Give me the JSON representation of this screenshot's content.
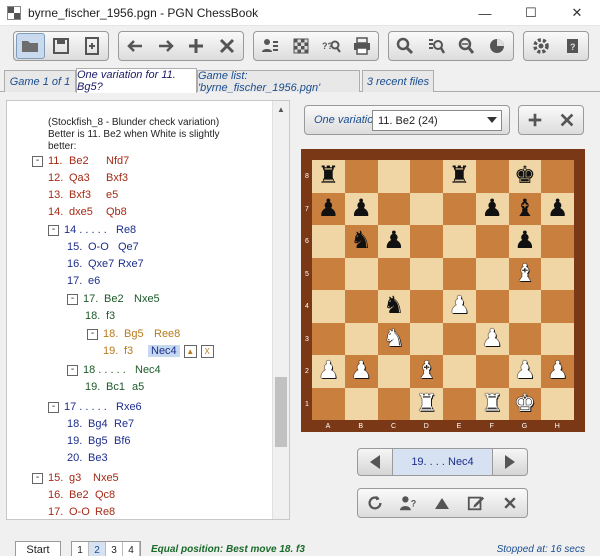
{
  "window": {
    "title": "byrne_fischer_1956.pgn - PGN ChessBook",
    "minimize": "—",
    "maximize": "☐",
    "close": "✕"
  },
  "toolbar": {
    "groups": [
      [
        "folder-open-icon",
        "save-icon",
        "new-file-icon"
      ],
      [
        "back-arrow-icon",
        "forward-arrow-icon",
        "add-icon",
        "delete-icon"
      ],
      [
        "player-list-icon",
        "board-icon",
        "search-position-icon",
        "print-icon"
      ],
      [
        "zoom-icon",
        "search-games-icon",
        "search-moves-icon",
        "stats-icon"
      ],
      [
        "settings-icon",
        "book-icon"
      ]
    ]
  },
  "tabs": [
    {
      "label": "Game 1 of 1"
    },
    {
      "label": "One variation for 11. Bg5?"
    },
    {
      "label": "Game list:  'byrne_fischer_1956.pgn'"
    },
    {
      "label": "3 recent files"
    }
  ],
  "tree": {
    "comment": "(Stockfish_8 - Blunder check variation) Better is  11. Be2  when White is slightly better:",
    "lines": [
      {
        "tog": "-",
        "num": "11.",
        "w": "Be2",
        "b": "Nfd7",
        "color": "red"
      },
      {
        "num": "12.",
        "w": "Qa3",
        "b": "Bxf3",
        "color": "red"
      },
      {
        "num": "13.",
        "w": "Bxf3",
        "b": "e5",
        "color": "red"
      },
      {
        "num": "14.",
        "w": "dxe5",
        "b": "Qb8",
        "color": "red"
      },
      {
        "tog": "-",
        "num": "14 . . . . .",
        "w": "",
        "b": "Re8",
        "color": "blue"
      },
      {
        "num": "15.",
        "w": "O-O",
        "b": "Qe7",
        "color": "blue"
      },
      {
        "num": "16.",
        "w": "Qxe7",
        "b": "Rxe7",
        "color": "blue"
      },
      {
        "num": "17.",
        "w": "e6",
        "b": "",
        "color": "green"
      },
      {
        "tog": "-",
        "num": "17.",
        "w": "Be2",
        "b": "Nxe5",
        "color": "green"
      },
      {
        "num": "18.",
        "w": "f3",
        "b": "",
        "color": "green"
      },
      {
        "tog": "-",
        "num": "18.",
        "w": "Bg5",
        "b": "Ree8",
        "color": "orange"
      },
      {
        "num": "19.",
        "w": "f3",
        "b": "Nec4",
        "color": "orange"
      },
      {
        "tog": "-",
        "num": "18 . . . . .",
        "w": "",
        "b": "Nec4",
        "color": "green"
      },
      {
        "num": "19.",
        "w": "Bc1",
        "b": "a5",
        "color": "green"
      },
      {
        "tog": "-",
        "num": "17 . . . . .",
        "w": "",
        "b": "Rxe6",
        "color": "blue"
      },
      {
        "num": "18.",
        "w": "Bg4",
        "b": "Re7",
        "color": "blue"
      },
      {
        "num": "19.",
        "w": "Bg5",
        "b": "Bf6",
        "color": "blue"
      },
      {
        "num": "20.",
        "w": "Be3",
        "b": "",
        "color": "blue"
      },
      {
        "tog": "-",
        "num": "15.",
        "w": "g3",
        "b": "Nxe5",
        "color": "red"
      },
      {
        "num": "16.",
        "w": "Be2",
        "b": "Qc8",
        "color": "red"
      },
      {
        "num": "17.",
        "w": "O-O",
        "b": "Re8",
        "color": "red"
      }
    ],
    "mini_up": "▲",
    "mini_x": "X"
  },
  "variation": {
    "label": "One variation",
    "selected": "11.  Be2  (24)"
  },
  "board": {
    "ranks": [
      "8",
      "7",
      "6",
      "5",
      "4",
      "3",
      "2",
      "1"
    ],
    "files": [
      "A",
      "B",
      "C",
      "D",
      "E",
      "F",
      "G",
      "H"
    ],
    "pieces": [
      [
        "bR",
        "",
        "",
        "",
        "bR",
        "",
        "bK",
        ""
      ],
      [
        "bP",
        "bP",
        "",
        "",
        "",
        "bP",
        "bB",
        "bP"
      ],
      [
        "",
        "bN",
        "bP",
        "",
        "",
        "",
        "bP",
        ""
      ],
      [
        "",
        "",
        "",
        "",
        "",
        "",
        "wB",
        ""
      ],
      [
        "",
        "",
        "bN",
        "",
        "wP",
        "",
        "",
        ""
      ],
      [
        "",
        "",
        "wN",
        "",
        "",
        "wP",
        "",
        ""
      ],
      [
        "wP",
        "wP",
        "",
        "wB",
        "",
        "",
        "wP",
        "wP"
      ],
      [
        "",
        "",
        "",
        "wR",
        "",
        "wR",
        "wK",
        ""
      ]
    ]
  },
  "nav": {
    "move": "19. . . .  Nec4"
  },
  "status": {
    "start": "Start",
    "pages": [
      "1",
      "2",
      "3",
      "4"
    ],
    "current_page": "2",
    "equal": "Equal position:  Best move  18. f3",
    "stopped": "Stopped at:  16 secs"
  }
}
